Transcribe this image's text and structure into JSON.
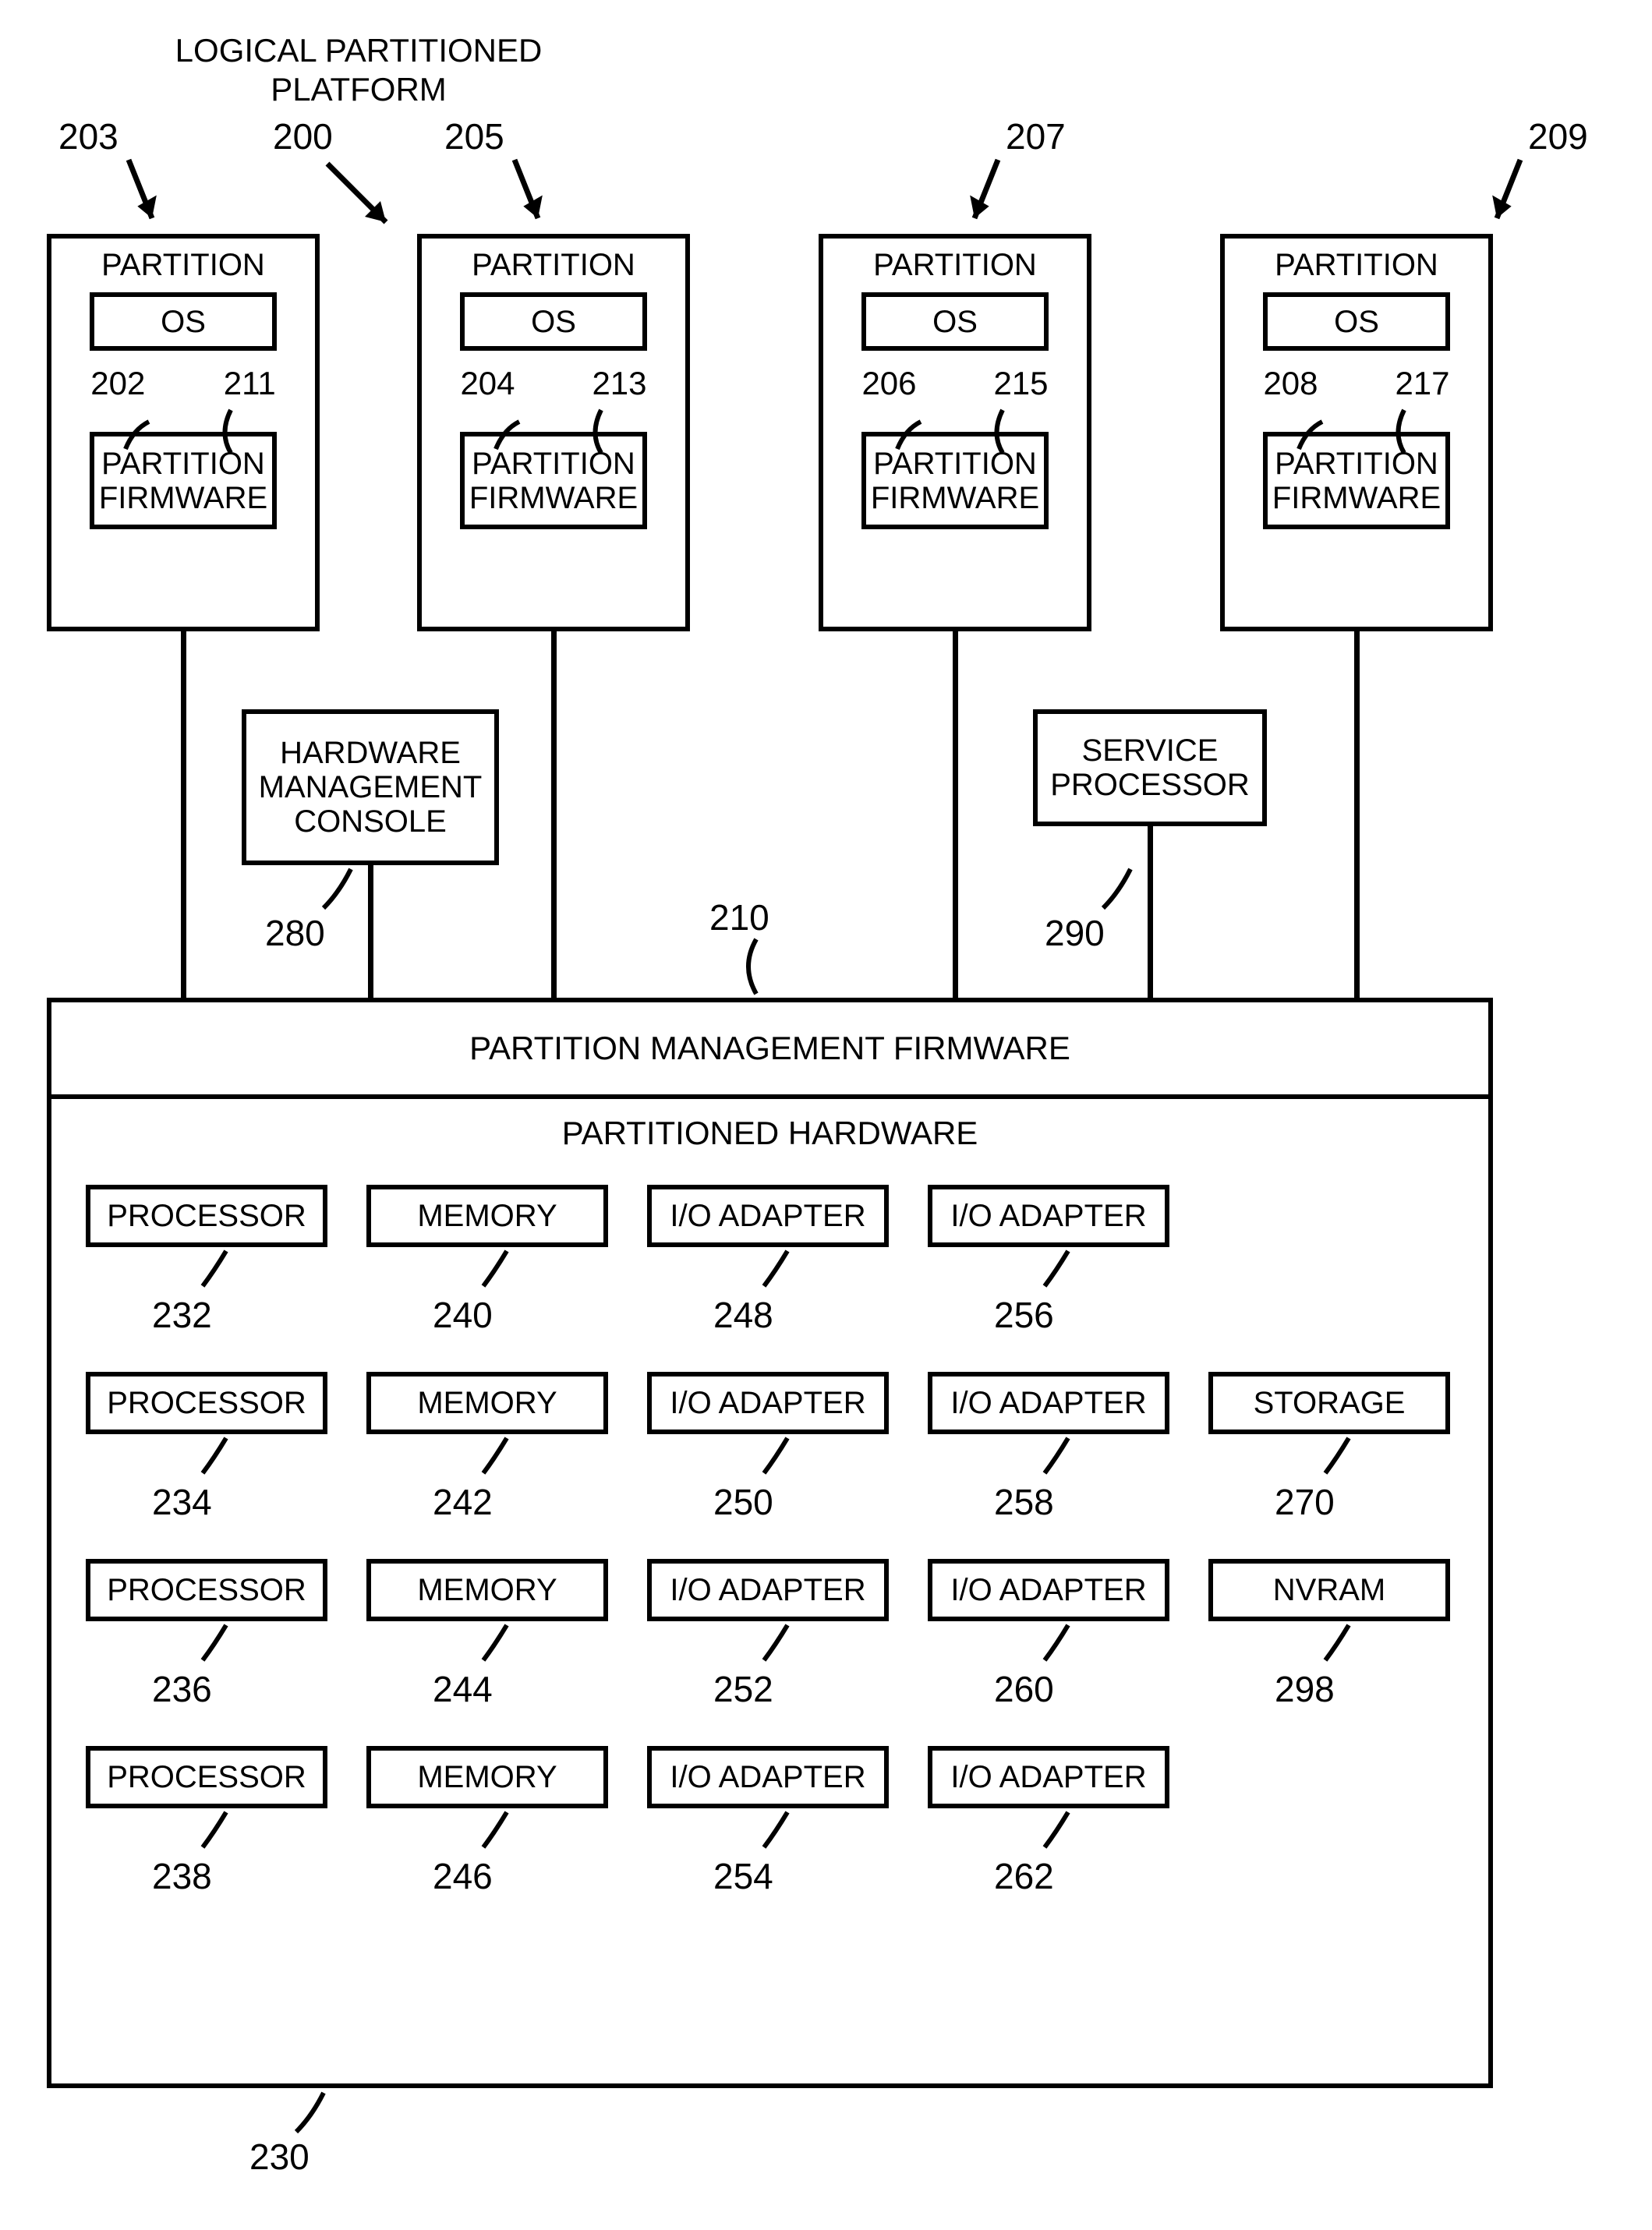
{
  "header": {
    "platform_label": "LOGICAL PARTITIONED\nPLATFORM",
    "platform_ref": "200"
  },
  "partitions": [
    {
      "ref": "203",
      "title": "PARTITION",
      "os": "OS",
      "os_ref": "202",
      "fw_ref": "211",
      "fw": "PARTITION\nFIRMWARE"
    },
    {
      "ref": "205",
      "title": "PARTITION",
      "os": "OS",
      "os_ref": "204",
      "fw_ref": "213",
      "fw": "PARTITION\nFIRMWARE"
    },
    {
      "ref": "207",
      "title": "PARTITION",
      "os": "OS",
      "os_ref": "206",
      "fw_ref": "215",
      "fw": "PARTITION\nFIRMWARE"
    },
    {
      "ref": "209",
      "title": "PARTITION",
      "os": "OS",
      "os_ref": "208",
      "fw_ref": "217",
      "fw": "PARTITION\nFIRMWARE"
    }
  ],
  "hmc": {
    "label": "HARDWARE\nMANAGEMENT\nCONSOLE",
    "ref": "280"
  },
  "svc": {
    "label": "SERVICE\nPROCESSOR",
    "ref": "290"
  },
  "pmf": {
    "label": "PARTITION MANAGEMENT FIRMWARE",
    "ref": "210"
  },
  "phw": {
    "label": "PARTITIONED HARDWARE",
    "ref": "230"
  },
  "hw": {
    "col1": [
      {
        "label": "PROCESSOR",
        "ref": "232"
      },
      {
        "label": "PROCESSOR",
        "ref": "234"
      },
      {
        "label": "PROCESSOR",
        "ref": "236"
      },
      {
        "label": "PROCESSOR",
        "ref": "238"
      }
    ],
    "col2": [
      {
        "label": "MEMORY",
        "ref": "240"
      },
      {
        "label": "MEMORY",
        "ref": "242"
      },
      {
        "label": "MEMORY",
        "ref": "244"
      },
      {
        "label": "MEMORY",
        "ref": "246"
      }
    ],
    "col3": [
      {
        "label": "I/O ADAPTER",
        "ref": "248"
      },
      {
        "label": "I/O ADAPTER",
        "ref": "250"
      },
      {
        "label": "I/O ADAPTER",
        "ref": "252"
      },
      {
        "label": "I/O ADAPTER",
        "ref": "254"
      }
    ],
    "col4": [
      {
        "label": "I/O ADAPTER",
        "ref": "256"
      },
      {
        "label": "I/O ADAPTER",
        "ref": "258"
      },
      {
        "label": "I/O ADAPTER",
        "ref": "260"
      },
      {
        "label": "I/O ADAPTER",
        "ref": "262"
      }
    ],
    "col5": [
      {
        "label": "STORAGE",
        "ref": "270"
      },
      {
        "label": "NVRAM",
        "ref": "298"
      }
    ]
  }
}
